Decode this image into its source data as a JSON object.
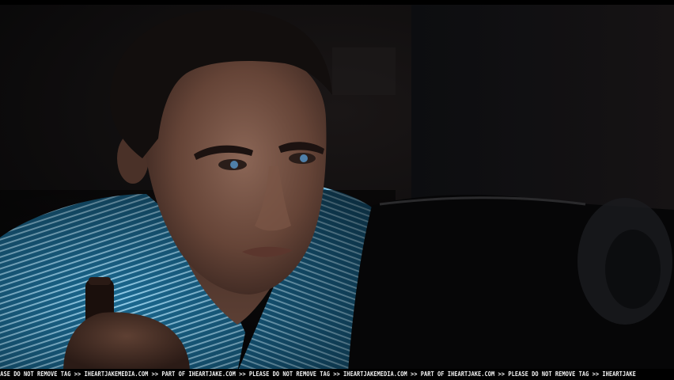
{
  "image": {
    "description_colors": {
      "background": "#0a0b0d",
      "shirt_base": "#1d6f9a",
      "shirt_stripe": "#9fd6ef",
      "skin_mid": "#6a4a3c",
      "skin_light": "#8a6655",
      "hair": "#141010",
      "monitor": "#070708"
    },
    "watermark_text": "EASE DO NOT REMOVE TAG >> IHEARTJAKEMEDIA.COM >> PART OF IHEARTJAKE.COM >> PLEASE DO NOT REMOVE TAG >> IHEARTJAKEMEDIA.COM >> PART OF IHEARTJAKE.COM >> PLEASE DO NOT REMOVE TAG >> IHEARTJAKE"
  }
}
